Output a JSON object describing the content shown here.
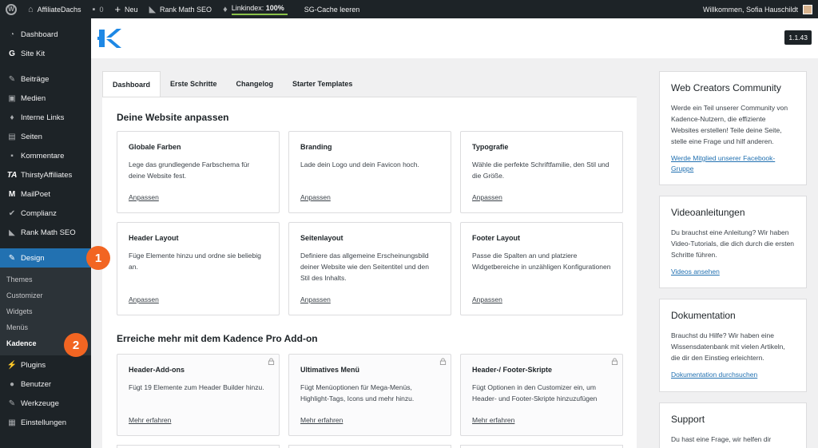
{
  "adminbar": {
    "site_name": "AffiliateDachs",
    "comments_count": "0",
    "new_label": "Neu",
    "rankmath_label": "Rank Math SEO",
    "linkindex_label": "Linkindex:",
    "linkindex_value": "100%",
    "cache_label": "SG-Cache leeren",
    "welcome": "Willkommen, Sofia Hauschildt"
  },
  "sidebar": {
    "items": [
      {
        "label": "Dashboard",
        "icon": "dashboard-icon"
      },
      {
        "label": "Site Kit",
        "icon": "sitekit-icon"
      },
      {
        "label": "Beiträge",
        "icon": "pin-icon"
      },
      {
        "label": "Medien",
        "icon": "media-icon"
      },
      {
        "label": "Interne Links",
        "icon": "link-icon"
      },
      {
        "label": "Seiten",
        "icon": "page-icon"
      },
      {
        "label": "Kommentare",
        "icon": "comment-icon"
      },
      {
        "label": "ThirstyAffiliates",
        "icon": "ta-icon"
      },
      {
        "label": "MailPoet",
        "icon": "mailpoet-icon"
      },
      {
        "label": "Complianz",
        "icon": "check-icon"
      },
      {
        "label": "Rank Math SEO",
        "icon": "rankmath-icon"
      },
      {
        "label": "Design",
        "icon": "brush-icon"
      },
      {
        "label": "Plugins",
        "icon": "plugin-icon"
      },
      {
        "label": "Benutzer",
        "icon": "user-icon"
      },
      {
        "label": "Werkzeuge",
        "icon": "wrench-icon"
      },
      {
        "label": "Einstellungen",
        "icon": "settings-icon"
      }
    ],
    "design_submenu": [
      "Themes",
      "Customizer",
      "Widgets",
      "Menüs",
      "Kadence"
    ]
  },
  "markers": [
    "1",
    "2"
  ],
  "header": {
    "version": "1.1.43"
  },
  "tabs": [
    "Dashboard",
    "Erste Schritte",
    "Changelog",
    "Starter Templates"
  ],
  "section1": {
    "title": "Deine Website anpassen",
    "cards": [
      {
        "title": "Globale Farben",
        "desc": "Lege das grundlegende Farbschema für deine Website fest.",
        "link": "Anpassen"
      },
      {
        "title": "Branding",
        "desc": "Lade dein Logo und dein Favicon hoch.",
        "link": "Anpassen"
      },
      {
        "title": "Typografie",
        "desc": "Wähle die perfekte Schriftfamilie, den Stil und die Größe.",
        "link": "Anpassen"
      },
      {
        "title": "Header Layout",
        "desc": "Füge Elemente hinzu und ordne sie beliebig an.",
        "link": "Anpassen"
      },
      {
        "title": "Seitenlayout",
        "desc": "Definiere das allgemeine Erscheinungsbild deiner Website wie den Seitentitel und den Stil des Inhalts.",
        "link": "Anpassen"
      },
      {
        "title": "Footer Layout",
        "desc": "Passe die Spalten an und platziere Widgetbereiche in unzähligen Konfigurationen",
        "link": "Anpassen"
      }
    ]
  },
  "section2": {
    "title": "Erreiche mehr mit dem Kadence Pro Add-on",
    "cards": [
      {
        "title": "Header-Add-ons",
        "desc": "Fügt 19 Elemente zum Header Builder hinzu.",
        "link": "Mehr erfahren"
      },
      {
        "title": "Ultimatives Menü",
        "desc": "Fügt Menüoptionen für Mega-Menüs, Highlight-Tags, Icons und mehr hinzu.",
        "link": "Mehr erfahren"
      },
      {
        "title": "Header-/ Footer-Skripte",
        "desc": "Fügt Optionen in den Customizer ein, um Header- und Footer-Skripte hinzuzufügen",
        "link": "Mehr erfahren"
      }
    ]
  },
  "rightbar": [
    {
      "title": "Web Creators Community",
      "desc": "Werde ein Teil unserer Community von Kadence-Nutzern, die effiziente Websites erstellen! Teile deine Seite, stelle eine Frage und hilf anderen.",
      "link": "Werde Mitglied unserer Facebook-Gruppe"
    },
    {
      "title": "Videoanleitungen",
      "desc": "Du brauchst eine Anleitung? Wir haben Video-Tutorials, die dich durch die ersten Schritte führen.",
      "link": "Videos ansehen"
    },
    {
      "title": "Dokumentation",
      "desc": "Brauchst du Hilfe? Wir haben eine Wissensdatenbank mit vielen Artikeln, die dir den Einstieg erleichtern.",
      "link": "Dokumentation durchsuchen"
    },
    {
      "title": "Support",
      "desc": "Du hast eine Frage, wir helfen dir",
      "link": ""
    }
  ],
  "colors": {
    "accent": "#2271b1",
    "admin_dark": "#1d2327",
    "marker": "#f26522",
    "kadence_blue": "#1e88e5"
  }
}
